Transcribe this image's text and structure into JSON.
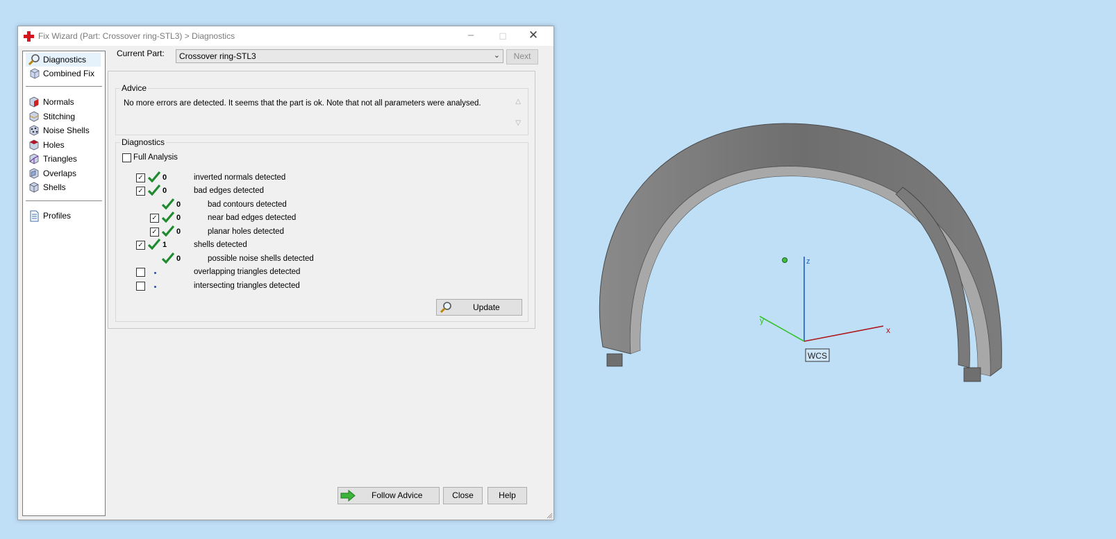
{
  "window": {
    "title": "Fix Wizard (Part: Crossover ring-STL3) > Diagnostics",
    "icon": "red-cross-icon",
    "controls": [
      "minimize",
      "maximize",
      "close"
    ]
  },
  "sidebar": {
    "items": [
      {
        "label": "Diagnostics",
        "icon": "magnifier-icon",
        "selected": true
      },
      {
        "label": "Combined Fix",
        "icon": "cube-icon"
      },
      {
        "label": "Normals",
        "icon": "normals-icon"
      },
      {
        "label": "Stitching",
        "icon": "stitching-icon"
      },
      {
        "label": "Noise Shells",
        "icon": "noise-shells-icon"
      },
      {
        "label": "Holes",
        "icon": "holes-icon"
      },
      {
        "label": "Triangles",
        "icon": "triangles-icon"
      },
      {
        "label": "Overlaps",
        "icon": "overlaps-icon"
      },
      {
        "label": "Shells",
        "icon": "shells-icon"
      },
      {
        "label": "Profiles",
        "icon": "document-icon"
      }
    ]
  },
  "current_part": {
    "label": "Current Part:",
    "value": "Crossover ring-STL3",
    "next_label": "Next"
  },
  "advice": {
    "legend": "Advice",
    "text": "No more errors are detected. It seems that the part is ok. Note that not all parameters were analysed."
  },
  "diagnostics": {
    "legend": "Diagnostics",
    "full_analysis": {
      "label": "Full Analysis",
      "checked": false
    },
    "rows": [
      {
        "checkbox": true,
        "checked": true,
        "status": "ok",
        "count": "0",
        "label": "inverted normals detected",
        "indent": 0
      },
      {
        "checkbox": true,
        "checked": true,
        "status": "ok",
        "count": "0",
        "label": "bad edges detected",
        "indent": 0
      },
      {
        "checkbox": false,
        "checked": false,
        "status": "ok",
        "count": "0",
        "label": "bad contours detected",
        "indent": 1
      },
      {
        "checkbox": true,
        "checked": true,
        "status": "ok",
        "count": "0",
        "label": "near bad edges detected",
        "indent": 1
      },
      {
        "checkbox": true,
        "checked": true,
        "status": "ok",
        "count": "0",
        "label": "planar holes detected",
        "indent": 1
      },
      {
        "checkbox": true,
        "checked": true,
        "status": "ok",
        "count": "1",
        "label": "shells detected",
        "indent": 0
      },
      {
        "checkbox": false,
        "checked": false,
        "status": "ok",
        "count": "0",
        "label": "possible noise shells detected",
        "indent": 1
      },
      {
        "checkbox": true,
        "checked": false,
        "status": "pending",
        "count": "",
        "label": "overlapping triangles detected",
        "indent": 0
      },
      {
        "checkbox": true,
        "checked": false,
        "status": "pending",
        "count": "",
        "label": "intersecting triangles detected",
        "indent": 0
      }
    ],
    "update_label": "Update"
  },
  "buttons": {
    "follow_advice": "Follow Advice",
    "close": "Close",
    "help": "Help"
  },
  "viewport": {
    "axes": {
      "x": "x",
      "y": "y",
      "z": "z"
    },
    "wcs_label": "WCS",
    "colors": {
      "background": "#bfdff7",
      "x_axis": "#b0141c",
      "y_axis": "#35c22e",
      "z_axis": "#1f5fbf",
      "model": "#8a8a8a"
    }
  }
}
